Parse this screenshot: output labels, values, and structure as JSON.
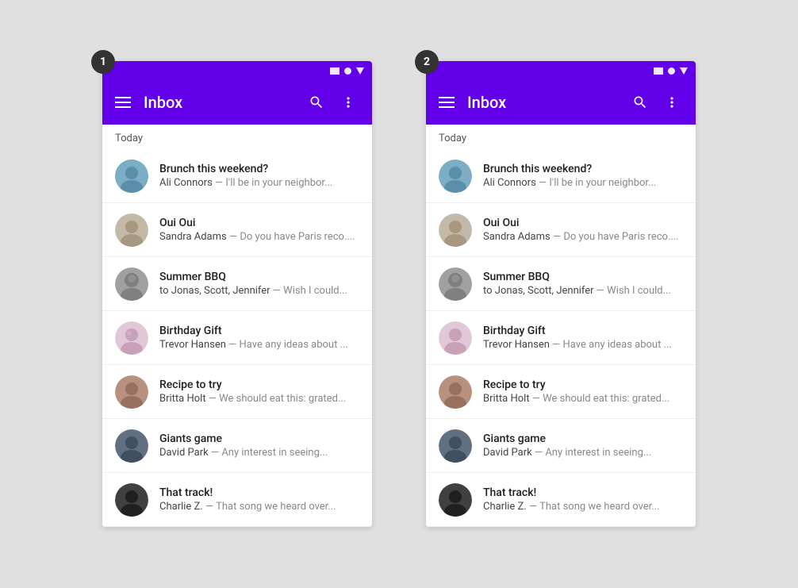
{
  "screen1": {
    "number": "1",
    "statusBar": {
      "icons": [
        "rect",
        "circle",
        "triangle"
      ]
    },
    "toolbar": {
      "title": "Inbox",
      "menuIcon": "menu",
      "searchIcon": "search",
      "moreIcon": "more-vert"
    },
    "sectionHeader": "Today",
    "emails": [
      {
        "id": "brunch",
        "subject": "Brunch this weekend?",
        "sender": "Ali Connors",
        "preview": " — I'll be in your neighbor...",
        "avatarType": "ali"
      },
      {
        "id": "ouioui",
        "subject": "Oui Oui",
        "sender": "Sandra Adams",
        "preview": " — Do you have Paris reco....",
        "avatarType": "sandra"
      },
      {
        "id": "summer",
        "subject": "Summer BBQ",
        "sender": "to Jonas, Scott, Jennifer",
        "preview": " — Wish I could...",
        "avatarType": "jonas"
      },
      {
        "id": "birthday",
        "subject": "Birthday Gift",
        "sender": "Trevor Hansen",
        "preview": " — Have any ideas about ...",
        "avatarType": "trevor"
      },
      {
        "id": "recipe",
        "subject": "Recipe to try",
        "sender": "Britta Holt",
        "preview": " — We should eat this: grated...",
        "avatarType": "britta"
      },
      {
        "id": "giants",
        "subject": "Giants game",
        "sender": "David Park",
        "preview": " — Any interest in seeing...",
        "avatarType": "david"
      },
      {
        "id": "track",
        "subject": "That track!",
        "sender": "Charlie Z.",
        "preview": " — That song we heard over...",
        "avatarType": "charlie"
      }
    ]
  },
  "screen2": {
    "number": "2",
    "statusBar": {
      "icons": [
        "rect",
        "circle",
        "triangle"
      ]
    },
    "toolbar": {
      "title": "Inbox",
      "menuIcon": "menu",
      "searchIcon": "search",
      "moreIcon": "more-vert"
    },
    "sectionHeader": "Today",
    "emails": [
      {
        "id": "brunch",
        "subject": "Brunch this weekend?",
        "sender": "Ali Connors",
        "preview": " — I'll be in your neighbor...",
        "avatarType": "ali"
      },
      {
        "id": "ouioui",
        "subject": "Oui Oui",
        "sender": "Sandra Adams",
        "preview": " — Do you have Paris reco....",
        "avatarType": "sandra"
      },
      {
        "id": "summer",
        "subject": "Summer BBQ",
        "sender": "to Jonas, Scott, Jennifer",
        "preview": " — Wish I could...",
        "avatarType": "jonas"
      },
      {
        "id": "birthday",
        "subject": "Birthday Gift",
        "sender": "Trevor Hansen",
        "preview": " — Have any ideas about ...",
        "avatarType": "trevor"
      },
      {
        "id": "recipe",
        "subject": "Recipe to try",
        "sender": "Britta Holt",
        "preview": " — We should eat this: grated...",
        "avatarType": "britta"
      },
      {
        "id": "giants",
        "subject": "Giants game",
        "sender": "David Park",
        "preview": " — Any interest in seeing...",
        "avatarType": "david"
      },
      {
        "id": "track",
        "subject": "That track!",
        "sender": "Charlie Z.",
        "preview": " — That song we heard over...",
        "avatarType": "charlie"
      }
    ]
  },
  "avatarColors": {
    "ali": "#7badc4",
    "sandra": "#c4b8a8",
    "jonas": "#a8a8a8",
    "trevor": "#e8c8d8",
    "britta": "#b89080",
    "david": "#708090",
    "charlie": "#404040"
  },
  "accentColor": "#6200ea"
}
